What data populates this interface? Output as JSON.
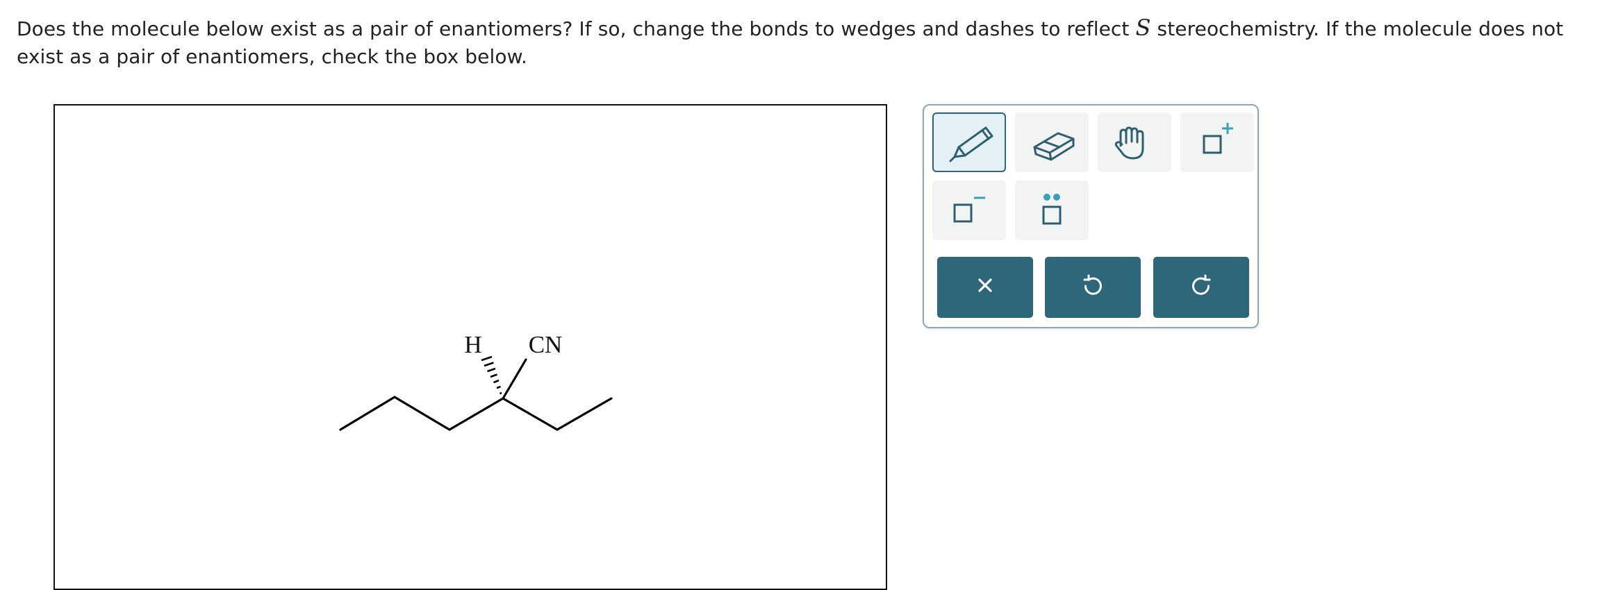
{
  "question": {
    "text_before": "Does the molecule below exist as a pair of enantiomers? If so, change the bonds to wedges and dashes to reflect ",
    "stereo_label": "S",
    "text_after": " stereochemistry. If the molecule does not exist as a pair of enantiomers, check the box below."
  },
  "molecule": {
    "atom_labels": {
      "hydrogen": "H",
      "nitrile": "CN"
    }
  },
  "toolbar": {
    "tools": [
      {
        "icon": "pencil-icon",
        "selected": true
      },
      {
        "icon": "eraser-icon",
        "selected": false
      },
      {
        "icon": "hand-icon",
        "selected": false
      },
      {
        "icon": "positive-charge-icon",
        "selected": false
      },
      {
        "icon": "negative-charge-icon",
        "selected": false
      },
      {
        "icon": "lone-pair-icon",
        "selected": false
      }
    ],
    "actions": [
      {
        "icon": "close-icon"
      },
      {
        "icon": "undo-icon"
      },
      {
        "icon": "redo-icon"
      }
    ]
  },
  "colors": {
    "action_button": "#2d6779",
    "icon_stroke": "#2f5f6f",
    "charge_accent": "#3a9fb8",
    "selected_tool_bg": "#e3f1f6"
  }
}
